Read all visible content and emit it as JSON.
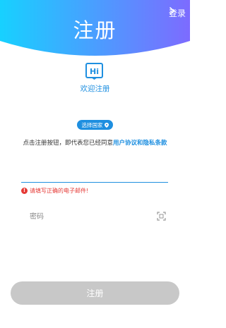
{
  "header": {
    "title": "注册",
    "login_label": "登录",
    "gradient_start": "#17d1ff",
    "gradient_end": "#7d6bff"
  },
  "logo": {
    "text": "Hi",
    "color": "#1e8fe0"
  },
  "welcome_text": "欢迎注册",
  "country_selector": {
    "label": "选择国家"
  },
  "agreement": {
    "prefix": "点击注册按钮，即代表您已经同意",
    "link_text": "用户协议和隐私条款"
  },
  "email_field": {
    "value": "",
    "placeholder": ""
  },
  "error": {
    "message": "请填写正确的电子邮件!"
  },
  "password_field": {
    "placeholder": "密码"
  },
  "register_button": {
    "label": "注册"
  },
  "colors": {
    "accent": "#1e8fe0",
    "error": "#e53935",
    "button_disabled": "#c8c8c8"
  }
}
